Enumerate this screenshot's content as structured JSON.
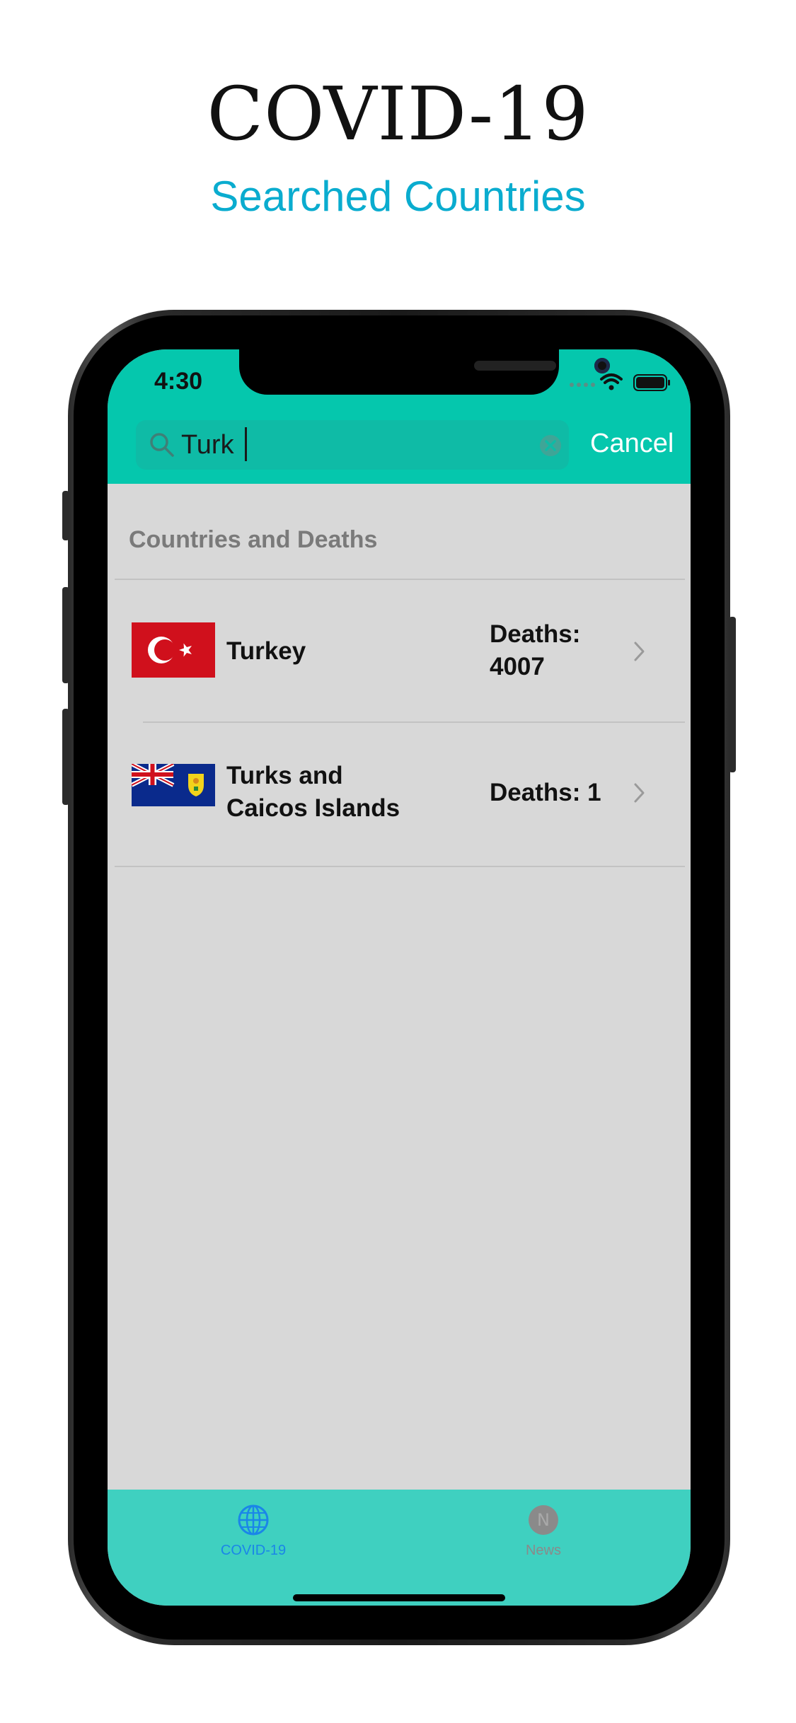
{
  "marketing": {
    "headline": "COVID-19",
    "subheadline": "Searched Countries"
  },
  "status_bar": {
    "time": "4:30"
  },
  "search": {
    "value": "Turk",
    "cancel_label": "Cancel"
  },
  "section_header": "Countries and Deaths",
  "rows": [
    {
      "country_lines": [
        "Turkey"
      ],
      "deaths_lines": [
        "Deaths:",
        "4007"
      ],
      "flag": "turkey-flag-icon"
    },
    {
      "country_lines": [
        "Turks and",
        "Caicos Islands"
      ],
      "deaths_lines": [
        "Deaths: 1"
      ],
      "flag": "turks-and-caicos-flag-icon"
    }
  ],
  "tabs": [
    {
      "label": "COVID-19",
      "icon": "globe-icon",
      "selected": true
    },
    {
      "label": "News",
      "icon": "news-icon",
      "selected": false
    }
  ],
  "colors": {
    "accent_teal": "#05c7ad",
    "tab_bar": "#3fd0c0",
    "subheadline_blue": "#0aaccf",
    "selected_tab": "#1a86e8",
    "unselected_tab": "#8a8a8a",
    "list_background": "#d8d8d8"
  }
}
